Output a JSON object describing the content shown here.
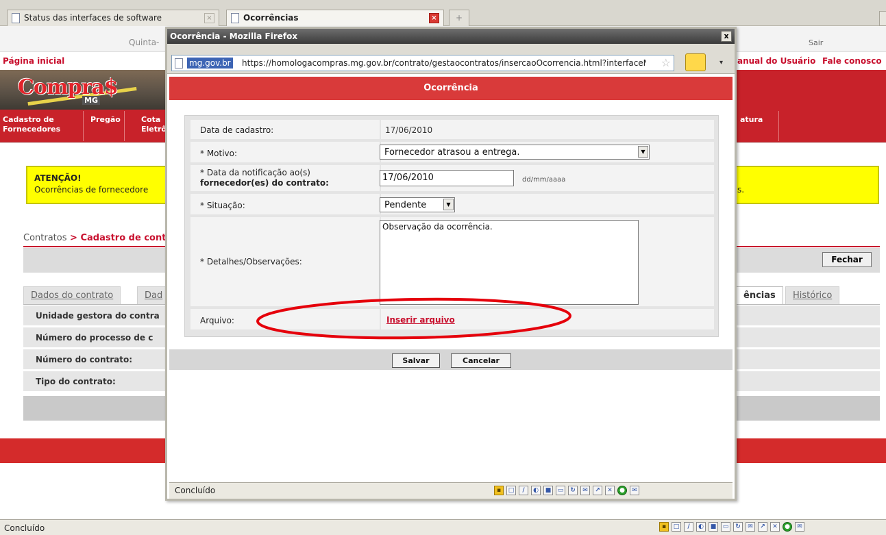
{
  "browser": {
    "tabs": [
      {
        "label": "Status das interfaces de software",
        "active": false
      },
      {
        "label": "Ocorrências",
        "active": true
      }
    ],
    "new_tab_symbol": "+",
    "status_text": "Concluído"
  },
  "site": {
    "date_partial": "Quinta-",
    "sair": "Sair",
    "nav": {
      "home": "Página inicial",
      "manual": "anual do Usuário",
      "contact": "Fale conosco"
    },
    "logo": {
      "text": "Compra$",
      "sub": "MG"
    },
    "menu": [
      {
        "line1": "Cadastro de",
        "line2": "Fornecedores"
      },
      {
        "line1": "Pregão",
        "line2": ""
      },
      {
        "line1": "Cota",
        "line2": "Eletrô"
      },
      {
        "line1": "atura",
        "line2": ""
      }
    ],
    "alert": {
      "title": "ATENÇÃO!",
      "text": "Ocorrências de fornecedore",
      "tail": "s."
    },
    "breadcrumb": {
      "root": "Contratos",
      "sep": " > ",
      "current": "Cadastro de cont"
    },
    "fechar": "Fechar",
    "content_tabs": [
      {
        "label": "Dados do contrato",
        "active": false
      },
      {
        "label": "Dad",
        "active": false
      },
      {
        "label": "ências",
        "active": true
      },
      {
        "label": "Histórico",
        "active": false
      }
    ],
    "detail_rows": [
      "Unidade gestora do contra",
      "Número do processo de c",
      "Número do contrato:",
      "Tipo do contrato:"
    ]
  },
  "popup": {
    "title": "Ocorrência - Mozilla Firefox",
    "close_symbol": "x",
    "url_domain": "mg.gov.br",
    "url": "https://homologacompras.mg.gov.br/contrato/gestaocontratos/insercaoOcorrencia.html?interfaceN",
    "header": "Ocorrência",
    "form": {
      "data_cadastro_label": "Data de cadastro:",
      "data_cadastro_value": "17/06/2010",
      "motivo_label": "* Motivo:",
      "motivo_value": "Fornecedor atrasou a entrega.",
      "notificacao_label_1": "* Data da notificação ao(s)",
      "notificacao_label_2": "fornecedor(es) do contrato:",
      "notificacao_value": "17/06/2010",
      "notificacao_hint": "dd/mm/aaaa",
      "situacao_label": "* Situação:",
      "situacao_value": "Pendente",
      "detalhes_label": "* Detalhes/Observações:",
      "detalhes_value": "Observação da ocorrência.",
      "arquivo_label": "Arquivo:",
      "arquivo_link": "Inserir arquivo"
    },
    "buttons": {
      "salvar": "Salvar",
      "cancelar": "Cancelar"
    },
    "status_text": "Concluído"
  },
  "colors": {
    "brand_red": "#c8222a",
    "popup_header_red": "#d93a3a",
    "alert_yellow": "#ffff00",
    "annotation_ellipse": "#e5000b"
  },
  "icons": [
    "page-icon",
    "close-icon",
    "star-icon",
    "folder-icon",
    "lock-icon",
    "dropdown-arrow-icon"
  ]
}
